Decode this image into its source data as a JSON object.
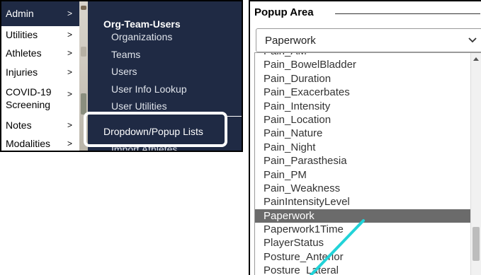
{
  "side_nav": {
    "items": [
      {
        "label": "Admin",
        "arrow": ">",
        "active": true
      },
      {
        "label": "Utilities",
        "arrow": ">"
      },
      {
        "label": "Athletes",
        "arrow": ">"
      },
      {
        "label": "Injuries",
        "arrow": ">"
      },
      {
        "label": "COVID-19 Screening",
        "arrow": ">"
      },
      {
        "label": "Notes",
        "arrow": ">"
      },
      {
        "label": "Modalities",
        "arrow": ">"
      }
    ]
  },
  "flyout": {
    "title": "Org-Team-Users",
    "items": [
      "Organizations",
      "Teams",
      "Users",
      "User Info Lookup",
      "User Utilities",
      "Dropdown/Popup Lists",
      "Import Athletes"
    ],
    "highlighted": "Dropdown/Popup Lists"
  },
  "popup_area": {
    "header": "Popup Area",
    "select_value": "Paperwork",
    "list_items": [
      "Pain_AM",
      "Pain_BowelBladder",
      "Pain_Duration",
      "Pain_Exacerbates",
      "Pain_Intensity",
      "Pain_Location",
      "Pain_Nature",
      "Pain_Night",
      "Pain_Parasthesia",
      "Pain_PM",
      "Pain_Weakness",
      "PainIntensityLevel",
      "Paperwork",
      "Paperwork1Time",
      "PlayerStatus",
      "Posture_Anterior",
      "Posture_Lateral"
    ],
    "selected_item": "Paperwork"
  },
  "colors": {
    "menu_bg": "#1f2a44",
    "selected_row": "#6b6b6b",
    "annotation": "#22d3d8"
  }
}
